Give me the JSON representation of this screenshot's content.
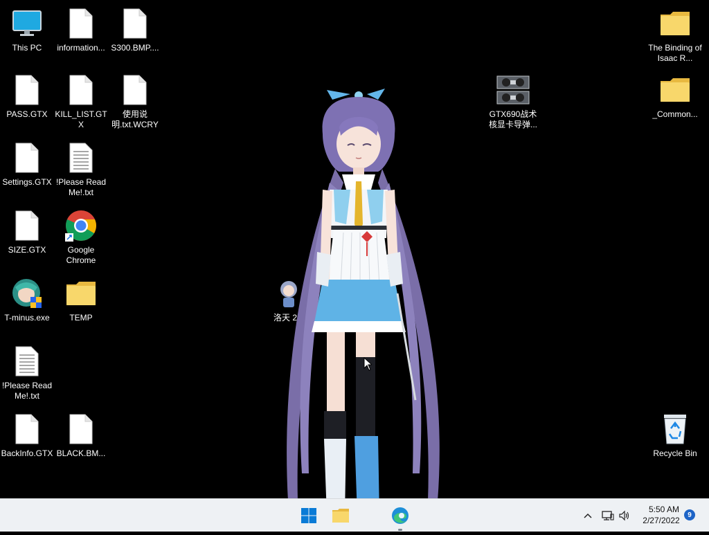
{
  "desktop": {
    "icons": [
      {
        "label": "This PC",
        "icon": "monitor-icon"
      },
      {
        "label": "information...",
        "icon": "file-icon"
      },
      {
        "label": "S300.BMP....",
        "icon": "file-icon"
      },
      {
        "label": "PASS.GTX",
        "icon": "file-icon"
      },
      {
        "label": "KILL_LIST.GTX",
        "icon": "file-icon"
      },
      {
        "label": "使用说明.txt.WCRY",
        "icon": "file-icon"
      },
      {
        "label": "Settings.GTX",
        "icon": "file-icon"
      },
      {
        "label": "!Please Read Me!.txt",
        "icon": "text-file-icon"
      },
      {
        "label": "SIZE.GTX",
        "icon": "file-icon"
      },
      {
        "label": "Google Chrome",
        "icon": "chrome-icon"
      },
      {
        "label": "T-minus.exe",
        "icon": "exe-icon"
      },
      {
        "label": "TEMP",
        "icon": "folder-icon"
      },
      {
        "label": "!Please Read Me!.txt",
        "icon": "text-file-icon"
      },
      {
        "label": "BackInfo.GTX",
        "icon": "file-icon"
      },
      {
        "label": "BLACK.BM...",
        "icon": "file-icon"
      },
      {
        "label": "GTX690战术核显卡导弹...",
        "icon": "gpu-icon"
      },
      {
        "label": "The Binding of Isaac R...",
        "icon": "folder-icon"
      },
      {
        "label": "_Common...",
        "icon": "folder-icon"
      },
      {
        "label": "Recycle Bin",
        "icon": "recycle-bin-icon"
      },
      {
        "label": "洛天 2.1",
        "icon": "character-icon"
      }
    ],
    "character_overlay": "anime-character-icon"
  },
  "taskbar": {
    "start_icon": "windows-start-icon",
    "pinned": [
      "file-explorer-icon",
      "edge-icon"
    ],
    "tray": {
      "chevron": "chevron-up-icon",
      "network": "network-icon",
      "volume": "volume-icon",
      "time": "5:50 AM",
      "date": "2/27/2022",
      "notification_count": "9"
    }
  },
  "colors": {
    "desktop_bg": "#000000",
    "taskbar_bg": "#eef1f4",
    "folder_yellow": "#f8d76b",
    "accent_blue": "#1d64c7"
  }
}
